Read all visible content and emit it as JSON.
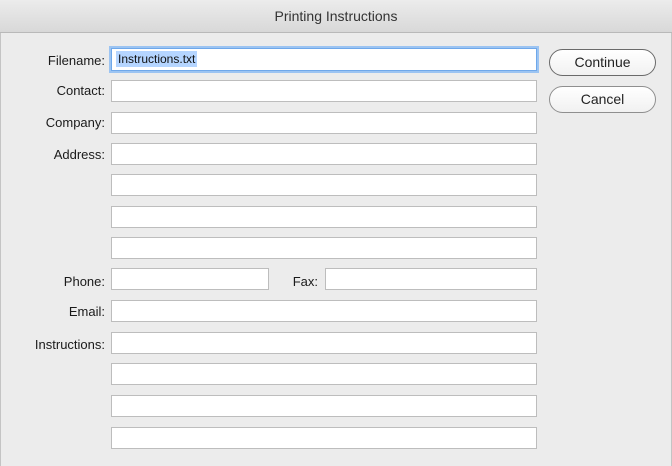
{
  "window": {
    "title": "Printing Instructions"
  },
  "form": {
    "filename_label": "Filename:",
    "filename_value": "Instructions.txt",
    "contact_label": "Contact:",
    "company_label": "Company:",
    "address_label": "Address:",
    "phone_label": "Phone:",
    "fax_label": "Fax:",
    "email_label": "Email:",
    "instructions_label": "Instructions:"
  },
  "buttons": {
    "continue_label": "Continue",
    "cancel_label": "Cancel"
  }
}
